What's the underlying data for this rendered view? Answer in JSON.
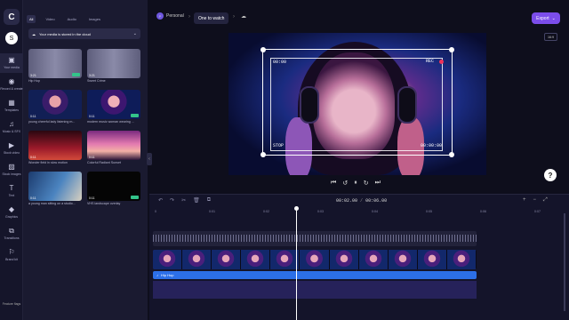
{
  "app": {
    "logo_letter": "C",
    "workspace": "Personal",
    "workspace_initial": "P",
    "project_title": "One to watch",
    "export_label": "Export",
    "aspect_ratio": "16:9",
    "user_initial": "S",
    "feature_request": "Feature flags"
  },
  "rail": [
    {
      "icon": "folder-icon",
      "glyph": "▣",
      "label": "Your media"
    },
    {
      "icon": "record-icon",
      "glyph": "◉",
      "label": "Record & create"
    },
    {
      "icon": "templates-icon",
      "glyph": "▦",
      "label": "Templates"
    },
    {
      "icon": "music-icon",
      "glyph": "♫",
      "label": "Music & SFX"
    },
    {
      "icon": "stock-video-icon",
      "glyph": "▶",
      "label": "Stock video"
    },
    {
      "icon": "stock-images-icon",
      "glyph": "▨",
      "label": "Stock images"
    },
    {
      "icon": "text-icon",
      "glyph": "T",
      "label": "Text"
    },
    {
      "icon": "graphics-icon",
      "glyph": "◆",
      "label": "Graphics"
    },
    {
      "icon": "transitions-icon",
      "glyph": "⧉",
      "label": "Transitions"
    },
    {
      "icon": "brand-kit-icon",
      "glyph": "⚐",
      "label": "Brand kit"
    }
  ],
  "media": {
    "tabs": [
      "All",
      "Video",
      "Audio",
      "Images"
    ],
    "notice": "Your media is stored in the cloud",
    "items": [
      {
        "caption": "Hip Hop",
        "duration": "3:21",
        "style": "wave",
        "badge": true
      },
      {
        "caption": "Sweet Crime",
        "duration": "3:21",
        "style": "wave",
        "badge": false
      },
      {
        "caption": "young cheerful lady listening m...",
        "duration": "0:11",
        "style": "face1",
        "badge": false
      },
      {
        "caption": "modern music woman wearing ...",
        "duration": "0:11",
        "style": "face2",
        "badge": true
      },
      {
        "caption": "Wonder field in slow motion",
        "duration": "0:11",
        "style": "redtrees",
        "badge": false
      },
      {
        "caption": "Colorful Radiant Sunset",
        "duration": "0:11",
        "style": "sunset",
        "badge": false
      },
      {
        "caption": "a young man sitting on a studio...",
        "duration": "0:11",
        "style": "man",
        "badge": false
      },
      {
        "caption": "VHS landscape overlay",
        "duration": "0:11",
        "style": "blackcard",
        "badge": true
      }
    ]
  },
  "preview": {
    "rec_label": "REC",
    "tag_tl": "00:00",
    "tag_bl": "STOP",
    "tag_br": "00:00:00"
  },
  "timeline": {
    "timecode_current": "00:02",
    "timecode_sep": ".00",
    "timecode_total": "00:06.00",
    "ruler": [
      "0",
      "0:01",
      "0:02",
      "0:03",
      "0:04",
      "0:05",
      "0:06",
      "0:07"
    ],
    "music_clip": "Hip Hop"
  }
}
